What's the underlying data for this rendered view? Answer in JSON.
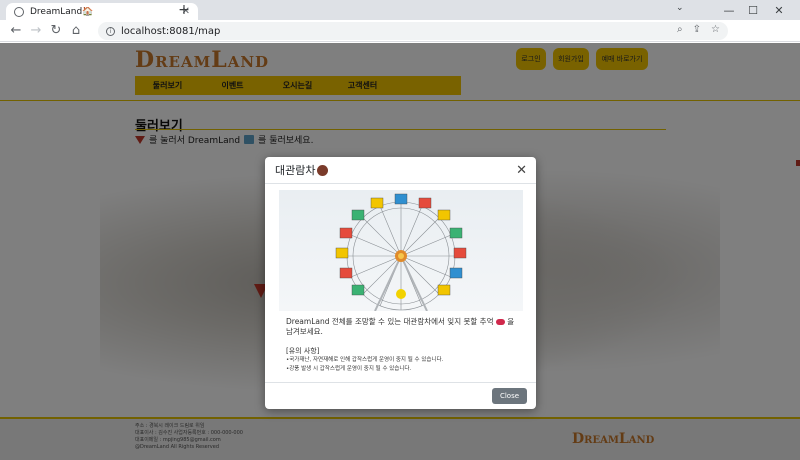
{
  "browser": {
    "tab_title": "DreamLand🏠",
    "tab_close": "✕",
    "new_tab": "+",
    "url": "localhost:8081/map",
    "window_controls": {
      "minimize": "—",
      "maximize": "☐",
      "close": "✕",
      "tabs_menu": "⌄"
    }
  },
  "site": {
    "logo": "DreamLand",
    "auth_buttons": [
      "로그인",
      "회원가입",
      "예매 바로가기"
    ],
    "menu": [
      "둘러보기",
      "이벤트",
      "오시는길",
      "고객센터"
    ],
    "section_title": "둘러보기",
    "section_desc_pre": "를 눌러서 DreamLand",
    "section_desc_post": "를 둘러보세요.",
    "footer_lines": [
      "주소 : 경북시 레이크 드림로 위임",
      "대표이사 : 김수진 사업자등록번호 : 000-000-000",
      "대표이메일 : mpjing985@gmail.com",
      "@DreamLand All Rights Reserved"
    ],
    "footer_logo": "DreamLand"
  },
  "modal": {
    "title": "대관람차",
    "close_icon": "✕",
    "description_pre": "DreamLand 전체를 조망할 수 있는 대관람차에서 잊지 못할 추억",
    "description_post": "을 남겨보세요.",
    "notice_title": "[유의 사항]",
    "notice_items": [
      "•국가재난, 자연재해로 인해 갑작스럽게 운영이 중지 될 수 있습니다.",
      "•강풍 발생 시 갑작스럽게 운영이 중지 될 수 있습니다."
    ],
    "close_button": "Close"
  },
  "colors": {
    "accent_yellow": "#f2c500",
    "logo_orange": "#c8782a",
    "marker_red": "#c0392b",
    "button_gray": "#6c757d"
  }
}
